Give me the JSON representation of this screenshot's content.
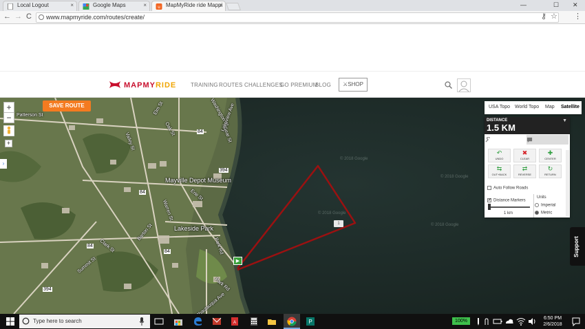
{
  "browser": {
    "tabs": [
      {
        "label": "Local Logout",
        "close": "×"
      },
      {
        "label": "Google Maps",
        "close": "×"
      },
      {
        "label": "MapMyRide ride Mappi",
        "close": "×"
      }
    ],
    "window_controls": {
      "minimize": "—",
      "maximize": "☐",
      "close": "✕"
    },
    "nav": {
      "back": "←",
      "forward": "→",
      "reload": "C"
    },
    "url": "www.mapmyride.com/routes/create/",
    "bookmark_star": "☆",
    "menu": "⋮",
    "key_icon": "⚷"
  },
  "site": {
    "logo": {
      "prefix": "MAPMY",
      "suffix": "RIDE"
    },
    "nav": [
      "TRAINING",
      "ROUTES",
      "CHALLENGES",
      "GO PREMIUM",
      "BLOG"
    ],
    "shop": "⚔SHOP",
    "search": "🔍"
  },
  "map": {
    "save_route": "SAVE ROUTE",
    "zoom_in": "+",
    "zoom_out": "−",
    "map_types": [
      {
        "label": "USA Topo",
        "active": false
      },
      {
        "label": "World Topo",
        "active": false
      },
      {
        "label": "Map",
        "active": false
      },
      {
        "label": "Satellite",
        "active": true
      }
    ],
    "labels": [
      "Patterson St",
      "Mayville Depot Museum",
      "Lakeside Park",
      "Park Rd",
      "Oak St",
      "Elm St",
      "Valley St",
      "Erie St",
      "Clark St",
      "Barton St",
      "Warren St",
      "Washington St",
      "Lakeview Ave",
      "Park Rd",
      "Summit St",
      "Chautauqua Ave",
      "Gear St"
    ],
    "shields": [
      "84",
      "84",
      "84",
      "394",
      "394",
      "84"
    ],
    "watermarks": [
      "© 2018 Google",
      "© 2018 Google",
      "© 2018 Google",
      "© 2018 Google"
    ],
    "route_color": "#9b1111",
    "km_marker": "1",
    "start_marker": "▶",
    "support": "Support"
  },
  "panel": {
    "distance_label": "DISTANCE",
    "distance_value": "1.5 KM",
    "toggle": "▼",
    "tabs": [
      "wrench-icon",
      "comment-icon"
    ],
    "tools": [
      {
        "label": "UNDO",
        "icon": "↶",
        "color": "#2e9e3e"
      },
      {
        "label": "CLEAR",
        "icon": "✖",
        "color": "#d7262b"
      },
      {
        "label": "CENTER",
        "icon": "✚",
        "color": "#2e9e3e"
      },
      {
        "label": "OUT+BACK",
        "icon": "⇆",
        "color": "#2e9e3e"
      },
      {
        "label": "REVERSE",
        "icon": "⇄",
        "color": "#2e9e3e"
      },
      {
        "label": "RETURN",
        "icon": "↻",
        "color": "#2e9e3e"
      }
    ],
    "auto_follow": "Auto Follow Roads",
    "distance_markers": "Distance Markers",
    "distance_markers_checked": "✔",
    "marker_interval": "1 km",
    "units_label": "Units",
    "units": [
      {
        "label": "Imperial",
        "selected": false
      },
      {
        "label": "Metric",
        "selected": true
      }
    ]
  },
  "taskbar": {
    "search_placeholder": "Type here to search",
    "battery": "100%",
    "time": "6:50 PM",
    "date": "2/6/2018"
  }
}
